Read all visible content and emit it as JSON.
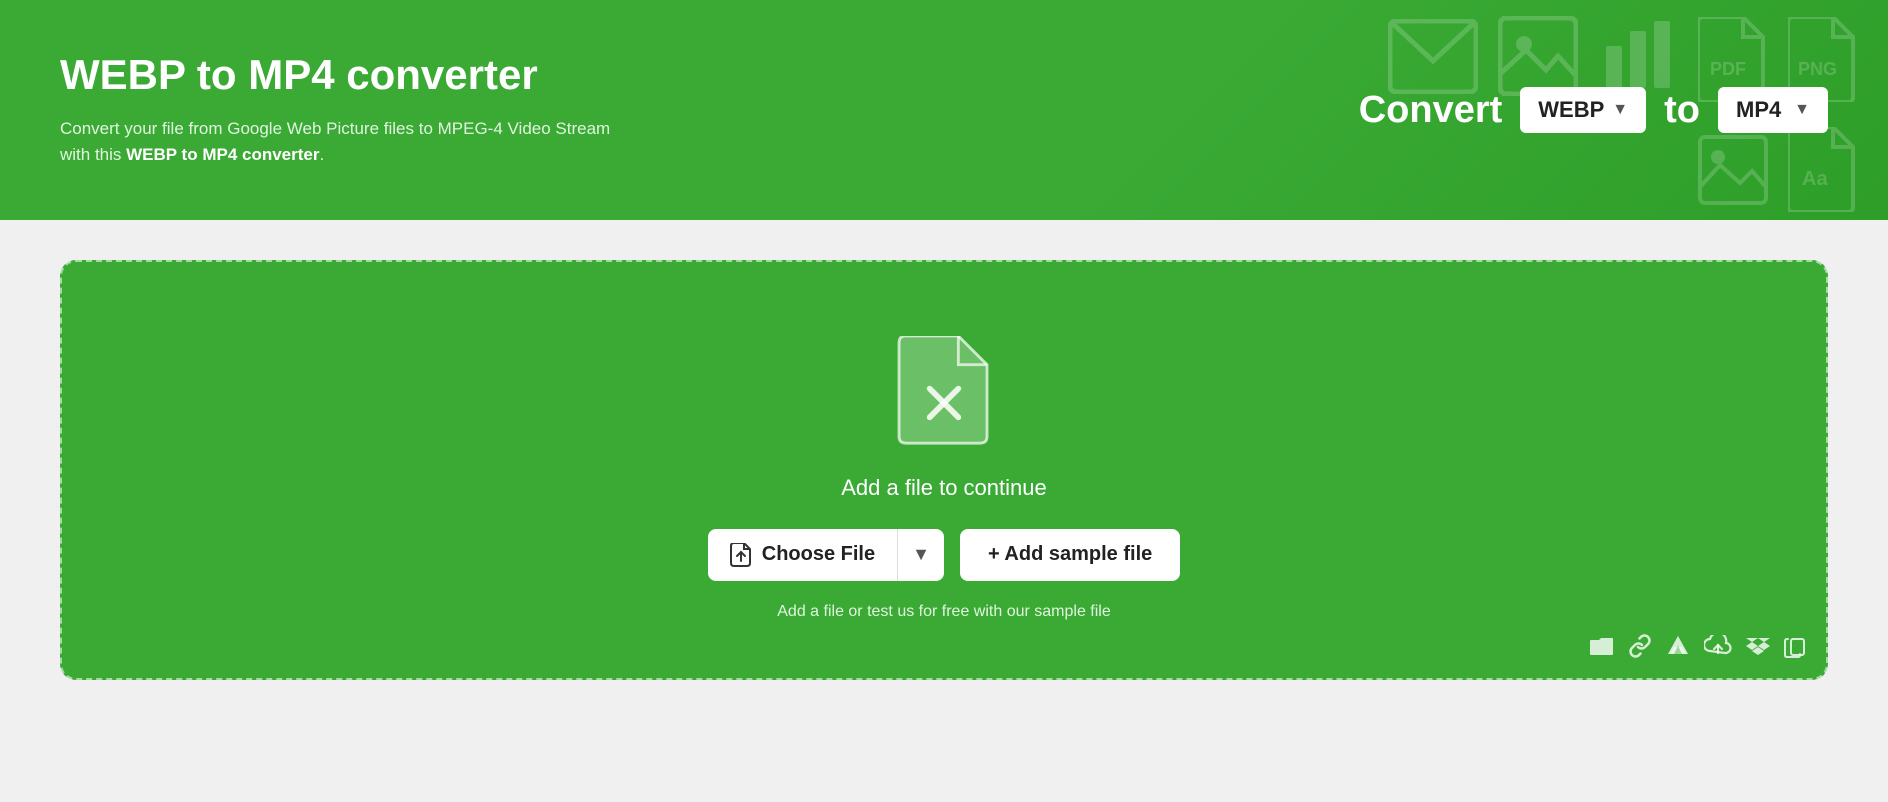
{
  "header": {
    "title": "WEBP to MP4 converter",
    "description_plain": "Convert your file from Google Web Picture files to MPEG-4 Video Stream with this ",
    "description_bold": "WEBP to MP4 converter",
    "description_end": ".",
    "convert_label": "Convert",
    "to_label": "to",
    "from_format": "WEBP",
    "to_format": "MP4"
  },
  "bg_icons": [
    "✉",
    "🖼",
    "📊",
    "PDF",
    "PNG",
    "🖼",
    "Aa"
  ],
  "dropzone": {
    "add_file_text": "Add a file to continue",
    "choose_file_label": "Choose File",
    "add_sample_label": "+ Add sample file",
    "helper_text": "Add a file or test us for free with our sample file"
  },
  "bottom_icons": [
    "folder",
    "link",
    "drive",
    "cloud",
    "dropbox",
    "copy"
  ]
}
